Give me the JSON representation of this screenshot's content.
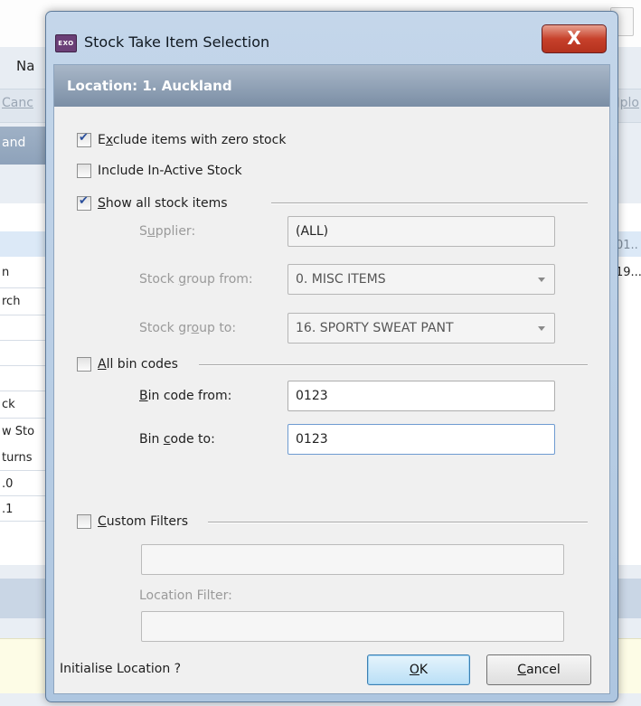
{
  "background": {
    "menu_text": "Na",
    "toolbar_left": "Canc",
    "toolbar_right": "Jplo",
    "band_text": "and",
    "left_rows": [
      "n",
      "rch",
      "",
      "",
      "ck",
      "w Sto",
      "turns",
      ".0",
      ".1"
    ],
    "right_rows": [
      "01..",
      "19..."
    ]
  },
  "dialog": {
    "title": "Stock Take Item Selection",
    "icon_text": "EXO",
    "close_glyph": "X",
    "location_banner": "Location:  1. Auckland",
    "exclude_zero": {
      "pre": "E",
      "key": "x",
      "post": "clude items with zero stock",
      "checked": true
    },
    "include_inactive": {
      "label": "Include In-Active Stock",
      "checked": false
    },
    "show_all": {
      "pre": "",
      "key": "S",
      "post": "how all stock items",
      "checked": true
    },
    "supplier": {
      "pre": "S",
      "key": "u",
      "post": "pplier:",
      "value": "(ALL)"
    },
    "group_from": {
      "pre": "Stock ",
      "key": "g",
      "post": "roup from:",
      "value": "0. MISC ITEMS"
    },
    "group_to": {
      "pre": "Stock gr",
      "key": "o",
      "post": "up to:",
      "value": "16. SPORTY SWEAT PANT"
    },
    "all_bins": {
      "pre": "",
      "key": "A",
      "post": "ll bin codes",
      "checked": false
    },
    "bin_from": {
      "pre": "",
      "key": "B",
      "post": "in code from:",
      "value": "0123"
    },
    "bin_to": {
      "pre": "Bin ",
      "key": "c",
      "post": "ode to:",
      "value": "0123"
    },
    "custom_filters": {
      "pre": "",
      "key": "C",
      "post": "ustom Filters",
      "checked": false,
      "value": ""
    },
    "location_filter": {
      "label": "Location Filter:",
      "value": ""
    },
    "initialise_text": "Initialise Location ?",
    "ok": {
      "pre": "",
      "key": "O",
      "post": "K"
    },
    "cancel": {
      "pre": "",
      "key": "C",
      "post": "ancel"
    }
  }
}
